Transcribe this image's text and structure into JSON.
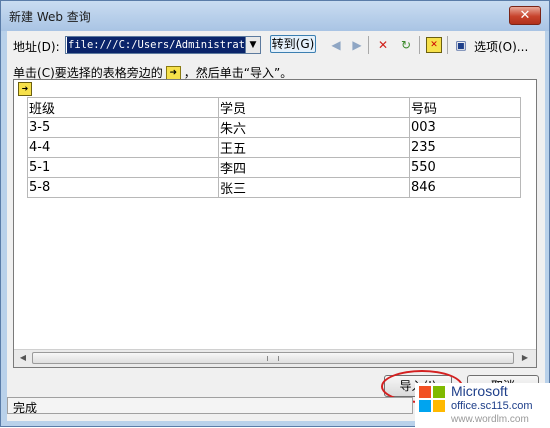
{
  "window": {
    "title": "新建 Web 查询",
    "close_label": "✕"
  },
  "toolbar": {
    "address_label": "地址(D):",
    "address_value": "file:///C:/Users/Administrator/",
    "go_label": "转到(G)",
    "options_label": "选项(O)...",
    "icons": [
      "back-icon",
      "forward-icon",
      "stop-icon",
      "refresh-icon",
      "hide-icons-icon",
      "save-query-icon"
    ]
  },
  "instruction": {
    "prefix": "单击",
    "mid": "要选择的表格旁边的",
    "suffix": "，然后单击“导入”。",
    "icon_glyph": "➜"
  },
  "table": {
    "rows": [
      [
        "班级",
        "学员",
        "号码"
      ],
      [
        "3-5",
        "朱六",
        "003"
      ],
      [
        "4-4",
        "王五",
        "235"
      ],
      [
        "5-1",
        "李四",
        "550"
      ],
      [
        "5-8",
        "张三",
        "846"
      ]
    ]
  },
  "buttons": {
    "import_label": "导入(I)",
    "cancel_label": "取消"
  },
  "status": {
    "text": "完成"
  },
  "watermark": {
    "brand": "Microsoft",
    "site": "office.sc115.com",
    "url": "www.wordlm.com"
  }
}
